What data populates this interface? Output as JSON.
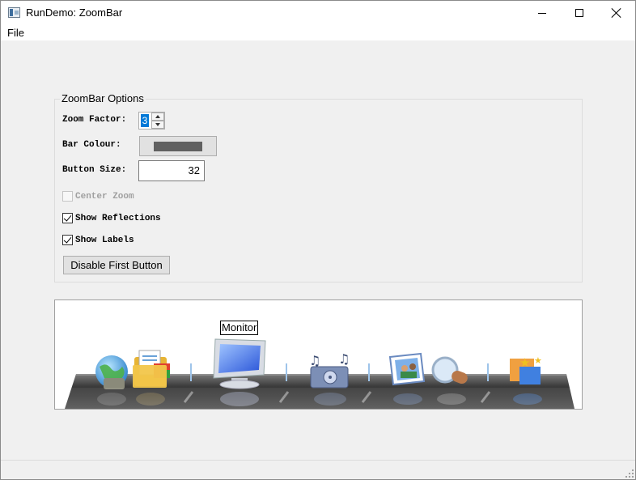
{
  "window": {
    "title": "RunDemo: ZoomBar"
  },
  "menu": {
    "items": [
      "File"
    ]
  },
  "options": {
    "group_title": "ZoomBar Options",
    "zoom_factor_label": "Zoom Factor:",
    "zoom_factor_value": "3",
    "bar_colour_label": "Bar Colour:",
    "bar_colour_value": "#606060",
    "button_size_label": "Button Size:",
    "button_size_value": "32",
    "center_zoom_label": "Center Zoom",
    "center_zoom_checked": false,
    "center_zoom_enabled": false,
    "show_reflections_label": "Show Reflections",
    "show_reflections_checked": true,
    "show_labels_label": "Show Labels",
    "show_labels_checked": true,
    "disable_first_button_label": "Disable First Button"
  },
  "zoombar": {
    "tooltip": "Monitor",
    "buttons": [
      {
        "icon": "globe-network-icon",
        "group": 1
      },
      {
        "icon": "folder-documents-icon",
        "group": 1
      },
      {
        "icon": "monitor-icon",
        "group": 2,
        "hovered": true
      },
      {
        "icon": "music-player-icon",
        "group": 3
      },
      {
        "icon": "photos-icon",
        "group": 4
      },
      {
        "icon": "magnifier-icon",
        "group": 4
      },
      {
        "icon": "paint-stars-icon",
        "group": 5
      }
    ]
  }
}
